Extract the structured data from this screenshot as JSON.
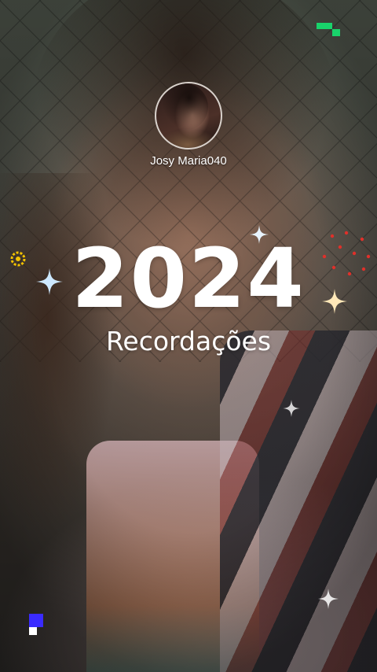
{
  "profile": {
    "username": "Josy Maria040"
  },
  "recap": {
    "year": "2024",
    "subtitle": "Recordações"
  },
  "colors": {
    "text": "#ffffff",
    "accent_green": "#19d36b",
    "accent_blue": "#3a2bff",
    "sparkle": "#cde8ff",
    "dots_red": "#e0302a",
    "ring_yellow": "#f2c200"
  },
  "icons": [
    "sparkle-icon",
    "ring-icon"
  ]
}
